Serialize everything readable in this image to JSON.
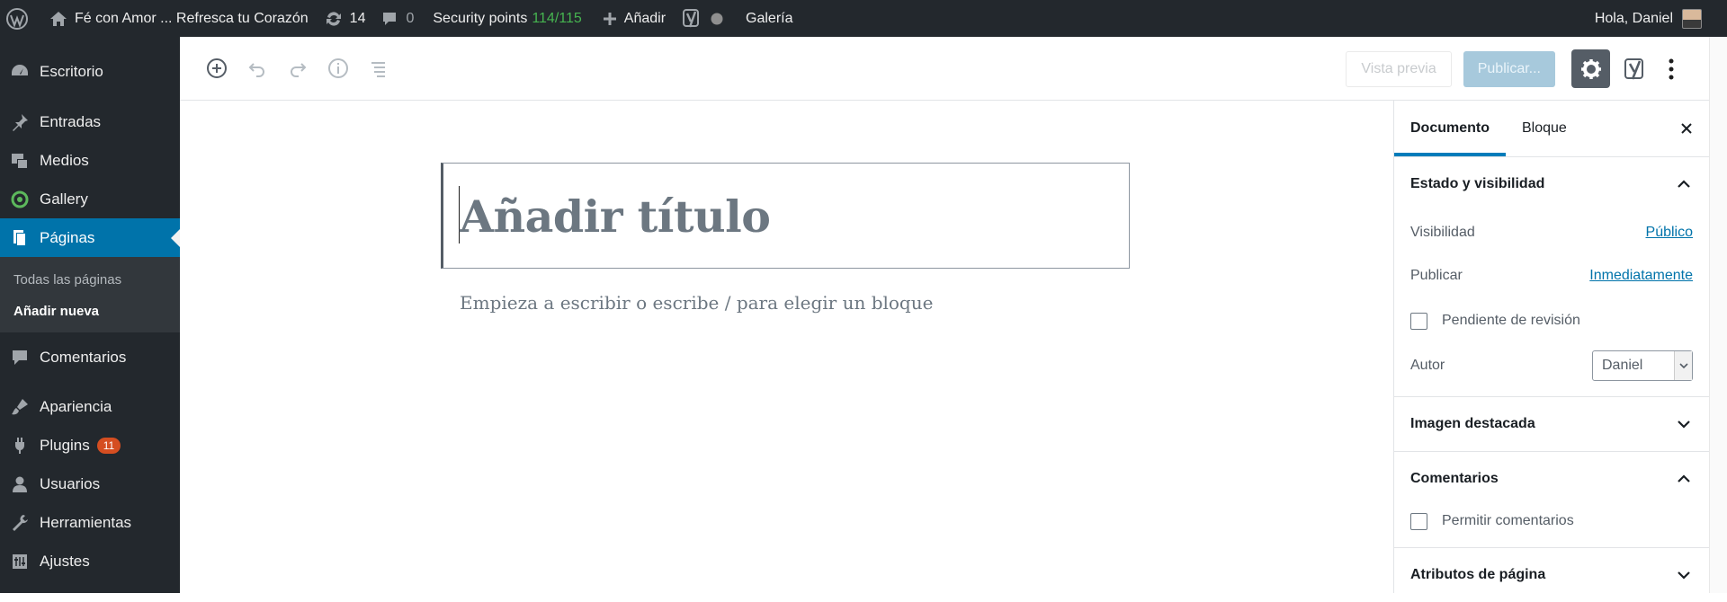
{
  "adminbar": {
    "site_name": "Fé con Amor ... Refresca tu Corazón",
    "updates_count": "14",
    "comments_count": "0",
    "security_label": "Security points",
    "security_value": "114/115",
    "add_new": "Añadir",
    "gallery": "Galería",
    "greeting": "Hola, Daniel"
  },
  "menu": {
    "items": [
      {
        "label": "Escritorio",
        "icon": "dashboard-icon"
      },
      {
        "label": "Entradas",
        "icon": "pin-icon"
      },
      {
        "label": "Medios",
        "icon": "media-icon"
      },
      {
        "label": "Gallery",
        "icon": "gallery-icon"
      },
      {
        "label": "Páginas",
        "icon": "pages-icon"
      },
      {
        "label": "Comentarios",
        "icon": "comments-icon"
      },
      {
        "label": "Apariencia",
        "icon": "appearance-icon"
      },
      {
        "label": "Plugins",
        "icon": "plugins-icon",
        "badge": "11"
      },
      {
        "label": "Usuarios",
        "icon": "users-icon"
      },
      {
        "label": "Herramientas",
        "icon": "tools-icon"
      },
      {
        "label": "Ajustes",
        "icon": "settings-icon"
      }
    ],
    "submenu": [
      "Todas las páginas",
      "Añadir nueva"
    ]
  },
  "toolbar": {
    "preview": "Vista previa",
    "publish": "Publicar..."
  },
  "editor": {
    "title_placeholder": "Añadir título",
    "block_placeholder": "Empieza a escribir o escribe / para elegir un bloque"
  },
  "sidebar": {
    "tabs": [
      "Documento",
      "Bloque"
    ],
    "status_panel": {
      "title": "Estado y visibilidad",
      "visibility_label": "Visibilidad",
      "visibility_value": "Público",
      "publish_label": "Publicar",
      "publish_value": "Inmediatamente",
      "pending_label": "Pendiente de revisión",
      "author_label": "Autor",
      "author_value": "Daniel"
    },
    "featured_image_title": "Imagen destacada",
    "comments_panel": {
      "title": "Comentarios",
      "allow_label": "Permitir comentarios"
    },
    "page_attributes_title": "Atributos de página"
  },
  "colors": {
    "admin_bg": "#23282d",
    "accent": "#0073aa",
    "green": "#46b450",
    "badge": "#d54e21"
  }
}
